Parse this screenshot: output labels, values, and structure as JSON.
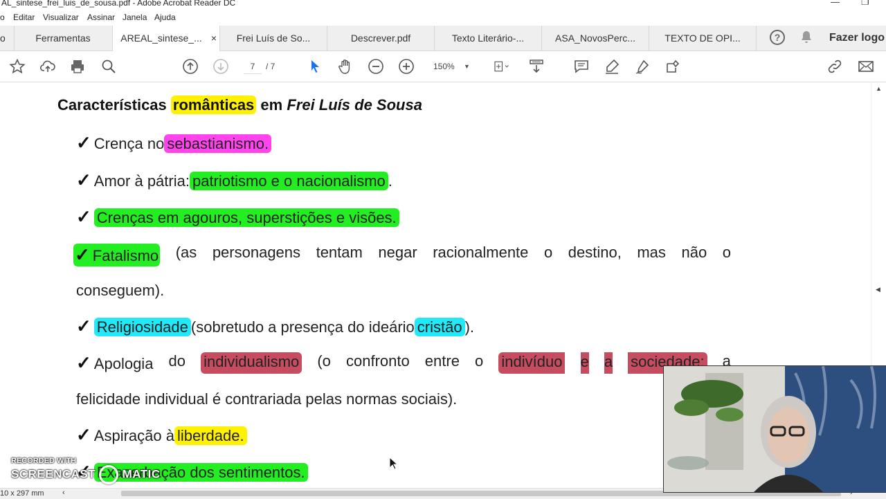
{
  "window": {
    "title": "AL_sintese_frei_luis_de_sousa.pdf - Adobe Acrobat Reader DC"
  },
  "menu": [
    "o",
    "Editar",
    "Visualizar",
    "Assinar",
    "Janela",
    "Ajuda"
  ],
  "tabs": {
    "home": "o",
    "tools": "Ferramentas",
    "docs": [
      "AREAL_sintese_...",
      "Frei Luís de So...",
      "Descrever.pdf",
      "Texto Literário-...",
      "ASA_NovosPerc...",
      "TEXTO DE OPI..."
    ],
    "close_glyph": "×",
    "login": "Fazer logo"
  },
  "toolbar": {
    "page_current": "7",
    "page_total": "/ 7",
    "zoom": "150%"
  },
  "document": {
    "heading_pre": "Características",
    "heading_hl": "românticas",
    "heading_mid": " em ",
    "heading_italic": "Frei Luís de Sousa",
    "check": "✓",
    "items": {
      "i1_a": "Crença no",
      "i1_b": "sebastianismo.",
      "i2_a": "Amor à pátria:",
      "i2_b": "patriotismo e o nacionalismo",
      "i2_c": ".",
      "i3_a": "Crenças em agouros, superstições e visões.",
      "i4_words": [
        "Fatalismo",
        "(as",
        "personagens",
        "tentam",
        "negar",
        "racionalmente",
        "o",
        "destino,",
        "mas",
        "não",
        "o"
      ],
      "i4_cont": "conseguem).",
      "i5_a": "Religiosidade",
      "i5_b": "(sobretudo a presença do ideário",
      "i5_c": "cristão",
      "i5_d": ").",
      "i6_words": [
        "Apologia",
        "do",
        "individualismo",
        "(o",
        "confronto",
        "entre",
        "o",
        "indivíduo",
        "e",
        "a",
        "sociedade;",
        "a"
      ],
      "i6_cont": "felicidade individual é contrariada pelas normas sociais).",
      "i7_a": "Aspiração à",
      "i7_b": "liberdade.",
      "i8_a": "Exacerbação dos sentimentos."
    }
  },
  "statusbar": {
    "page_size": "10 x 297 mm"
  },
  "watermark": {
    "line1": "RECORDED WITH",
    "line2": "SCREENCAST",
    "line3": "MATIC"
  },
  "colors": {
    "yellow": "#fff200",
    "magenta": "#ff44ee",
    "green": "#22ee22",
    "cyan": "#22e8f8",
    "red": "#c64d60",
    "accent_blue": "#1a73e8"
  }
}
